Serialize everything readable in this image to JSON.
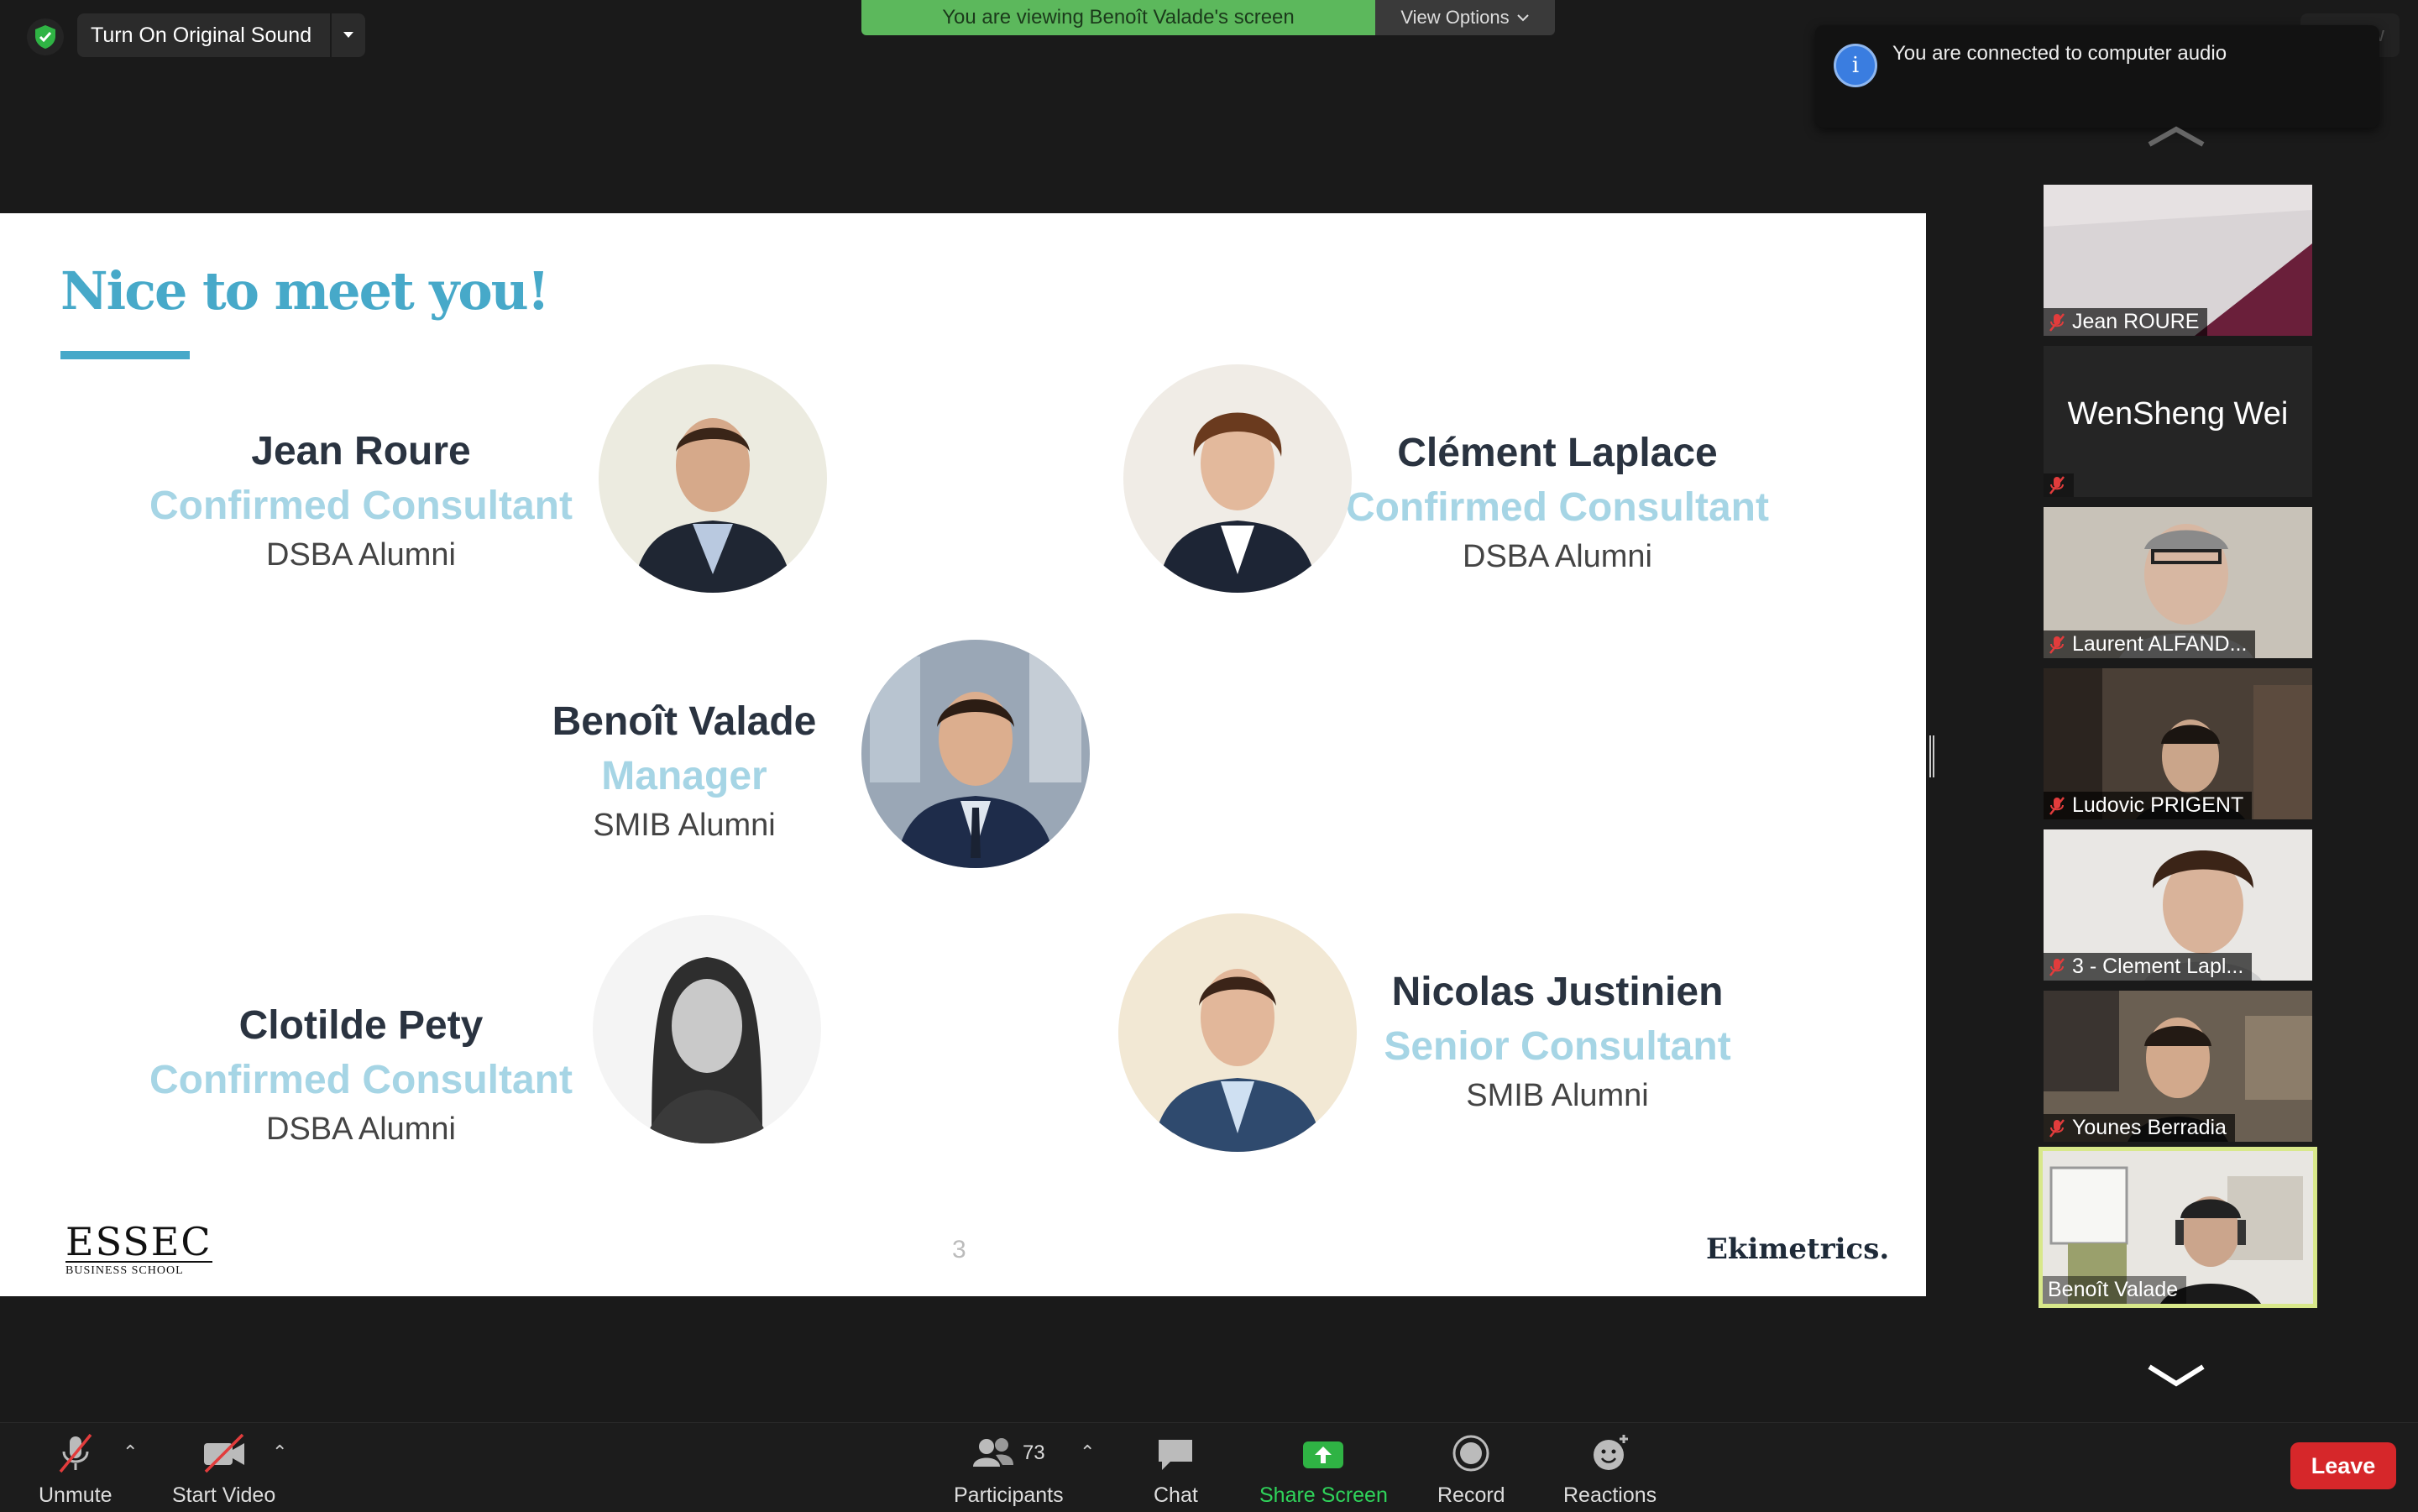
{
  "top": {
    "original_sound_label": "Turn On Original Sound",
    "viewing_banner": "You are viewing Benoît Valade's screen",
    "view_options_label": "View Options",
    "view_button_label": "View",
    "notification": "You are connected to computer audio"
  },
  "slide": {
    "title": "Nice to meet you!",
    "people": [
      {
        "name": "Jean Roure",
        "role": "Confirmed Consultant",
        "alumni": "DSBA Alumni"
      },
      {
        "name": "Clément Laplace",
        "role": "Confirmed Consultant",
        "alumni": "DSBA Alumni"
      },
      {
        "name": "Benoît Valade",
        "role": "Manager",
        "alumni": "SMIB Alumni"
      },
      {
        "name": "Clotilde Pety",
        "role": "Confirmed Consultant",
        "alumni": "DSBA Alumni"
      },
      {
        "name": "Nicolas Justinien",
        "role": "Senior Consultant",
        "alumni": "SMIB Alumni"
      }
    ],
    "page_number": "3",
    "logo_left": {
      "main": "ESSEC",
      "sub": "BUSINESS SCHOOL"
    },
    "logo_right": "Ekimetrics."
  },
  "gallery": {
    "participants": [
      {
        "name": "Jean ROURE"
      },
      {
        "name": "WenSheng Wei"
      },
      {
        "name": "Laurent ALFAND..."
      },
      {
        "name": "Ludovic PRIGENT"
      },
      {
        "name": "3 - Clement Lapl..."
      },
      {
        "name": "Younes Berradia"
      },
      {
        "name": "Benoît Valade"
      }
    ],
    "active_speaker_color": "#d8e88a"
  },
  "toolbar": {
    "unmute": "Unmute",
    "start_video": "Start Video",
    "participants": "Participants",
    "participants_count": "73",
    "chat": "Chat",
    "share_screen": "Share Screen",
    "record": "Record",
    "reactions": "Reactions",
    "leave": "Leave"
  },
  "colors": {
    "accent_teal": "#47a9c9",
    "role_light": "#a6d5e5",
    "share_green": "#2fb344",
    "leave_red": "#d6272a",
    "banner_green": "#5cb85c"
  }
}
